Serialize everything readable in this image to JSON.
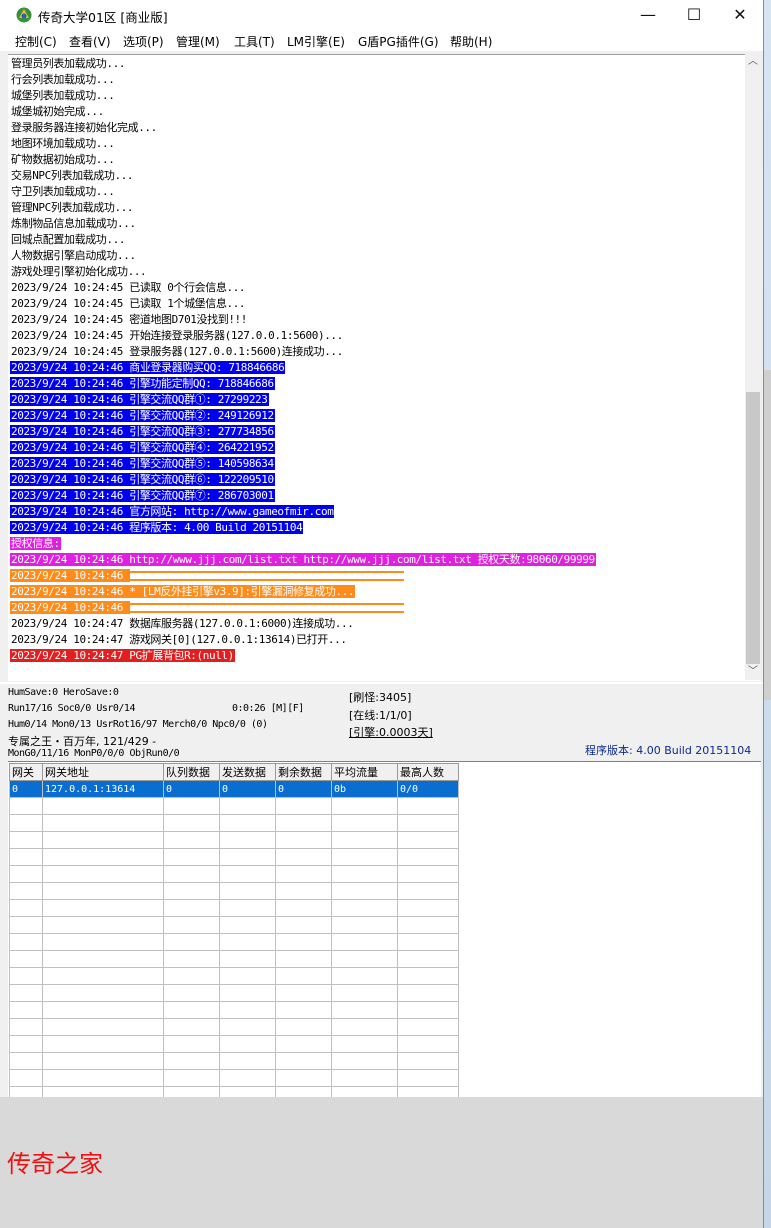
{
  "window": {
    "title": "传奇大学01区 [商业版]",
    "controls": {
      "minimize": "—",
      "maximize": "☐",
      "close": "✕"
    }
  },
  "menu": [
    "控制(C)",
    "查看(V)",
    "选项(P)",
    "管理(M)",
    "工具(T)",
    "LM引擎(E)",
    "G盾PG插件(G)",
    "帮助(H)"
  ],
  "log": [
    {
      "text": "管理员列表加载成功...",
      "style": "plain"
    },
    {
      "text": "行会列表加载成功...",
      "style": "plain"
    },
    {
      "text": "城堡列表加载成功...",
      "style": "plain"
    },
    {
      "text": "城堡城初始完成...",
      "style": "plain"
    },
    {
      "text": "登录服务器连接初始化完成...",
      "style": "plain"
    },
    {
      "text": "地图环境加载成功...",
      "style": "plain"
    },
    {
      "text": "矿物数据初始成功...",
      "style": "plain"
    },
    {
      "text": "交易NPC列表加载成功...",
      "style": "plain"
    },
    {
      "text": "守卫列表加载成功...",
      "style": "plain"
    },
    {
      "text": "管理NPC列表加载成功...",
      "style": "plain"
    },
    {
      "text": "炼制物品信息加载成功...",
      "style": "plain"
    },
    {
      "text": "回城点配置加载成功...",
      "style": "plain"
    },
    {
      "text": "人物数据引擎启动成功...",
      "style": "plain"
    },
    {
      "text": "游戏处理引擎初始化成功...",
      "style": "plain"
    },
    {
      "text": "2023/9/24 10:24:45 已读取 0个行会信息...",
      "style": "plain"
    },
    {
      "text": "2023/9/24 10:24:45 已读取 1个城堡信息...",
      "style": "plain"
    },
    {
      "text": "2023/9/24 10:24:45 密道地图D701没找到!!!",
      "style": "plain"
    },
    {
      "text": "2023/9/24 10:24:45 开始连接登录服务器(127.0.0.1:5600)...",
      "style": "plain"
    },
    {
      "text": "2023/9/24 10:24:45 登录服务器(127.0.0.1:5600)连接成功...",
      "style": "plain"
    },
    {
      "text": "2023/9/24 10:24:46 商业登录器购买QQ: 718846686",
      "style": "blue"
    },
    {
      "text": "2023/9/24 10:24:46 引擎功能定制QQ: 718846686",
      "style": "blue"
    },
    {
      "text": "2023/9/24 10:24:46 引擎交流QQ群①: 27299223",
      "style": "blue"
    },
    {
      "text": "2023/9/24 10:24:46 引擎交流QQ群②: 249126912",
      "style": "blue"
    },
    {
      "text": "2023/9/24 10:24:46 引擎交流QQ群③: 277734856",
      "style": "blue"
    },
    {
      "text": "2023/9/24 10:24:46 引擎交流QQ群④: 264221952",
      "style": "blue"
    },
    {
      "text": "2023/9/24 10:24:46 引擎交流QQ群⑤: 140598634",
      "style": "blue"
    },
    {
      "text": "2023/9/24 10:24:46 引擎交流QQ群⑥: 122209510",
      "style": "blue"
    },
    {
      "text": "2023/9/24 10:24:46 引擎交流QQ群⑦: 286703001",
      "style": "blue"
    },
    {
      "text": "2023/9/24 10:24:46 官方网站: http://www.gameofmir.com",
      "style": "blue"
    },
    {
      "text": "2023/9/24 10:24:46 程序版本: 4.00 Build 20151104",
      "style": "blue"
    },
    {
      "text": "授权信息:",
      "style": "magenta"
    },
    {
      "text": "2023/9/24 10:24:46 http://www.jjj.com/list.txt http://www.jjj.com/list.txt 授权天数:98060/99999",
      "style": "magenta"
    },
    {
      "text": "2023/9/24 10:24:46 ",
      "style": "orange-rule"
    },
    {
      "text": "2023/9/24 10:24:46 * [LM反外挂引擎v3.9]:引擎漏洞修复成功...",
      "style": "orange"
    },
    {
      "text": "2023/9/24 10:24:46 ",
      "style": "orange-rule"
    },
    {
      "text": "2023/9/24 10:24:47 数据库服务器(127.0.0.1:6000)连接成功...",
      "style": "plain"
    },
    {
      "text": "2023/9/24 10:24:47 游戏网关[0](127.0.0.1:13614)已打开...",
      "style": "plain"
    },
    {
      "text": "2023/9/24 10:24:47 PG扩展背包R:(null)",
      "style": "red"
    }
  ],
  "status": {
    "line1": "HumSave:0 HeroSave:0",
    "line2": "Run17/16 Soc0/0 Usr0/14",
    "timer": "0:0:26 [M][F]",
    "line3": "Hum0/14 Mon0/13 UsrRot16/97 Merch0/0 Npc0/0 (0)",
    "line4": "专属之王・百万年, 121/429 -",
    "line5": "MonG0/11/16 MonP0/0/0 ObjRun0/0",
    "refresh": "[刷怪:3405]",
    "online": "[在线:1/1/0]",
    "engine": "[引擎:0.0003天]",
    "version": "程序版本: 4.00 Build 20151104"
  },
  "grid": {
    "headers": [
      "网关",
      "网关地址",
      "队列数据",
      "发送数据",
      "剩余数据",
      "平均流量",
      "最高人数"
    ],
    "rows": [
      [
        "0",
        "127.0.0.1:13614",
        "0",
        "0",
        "0",
        "0b",
        "0/0"
      ]
    ]
  },
  "watermark": "传奇之家"
}
